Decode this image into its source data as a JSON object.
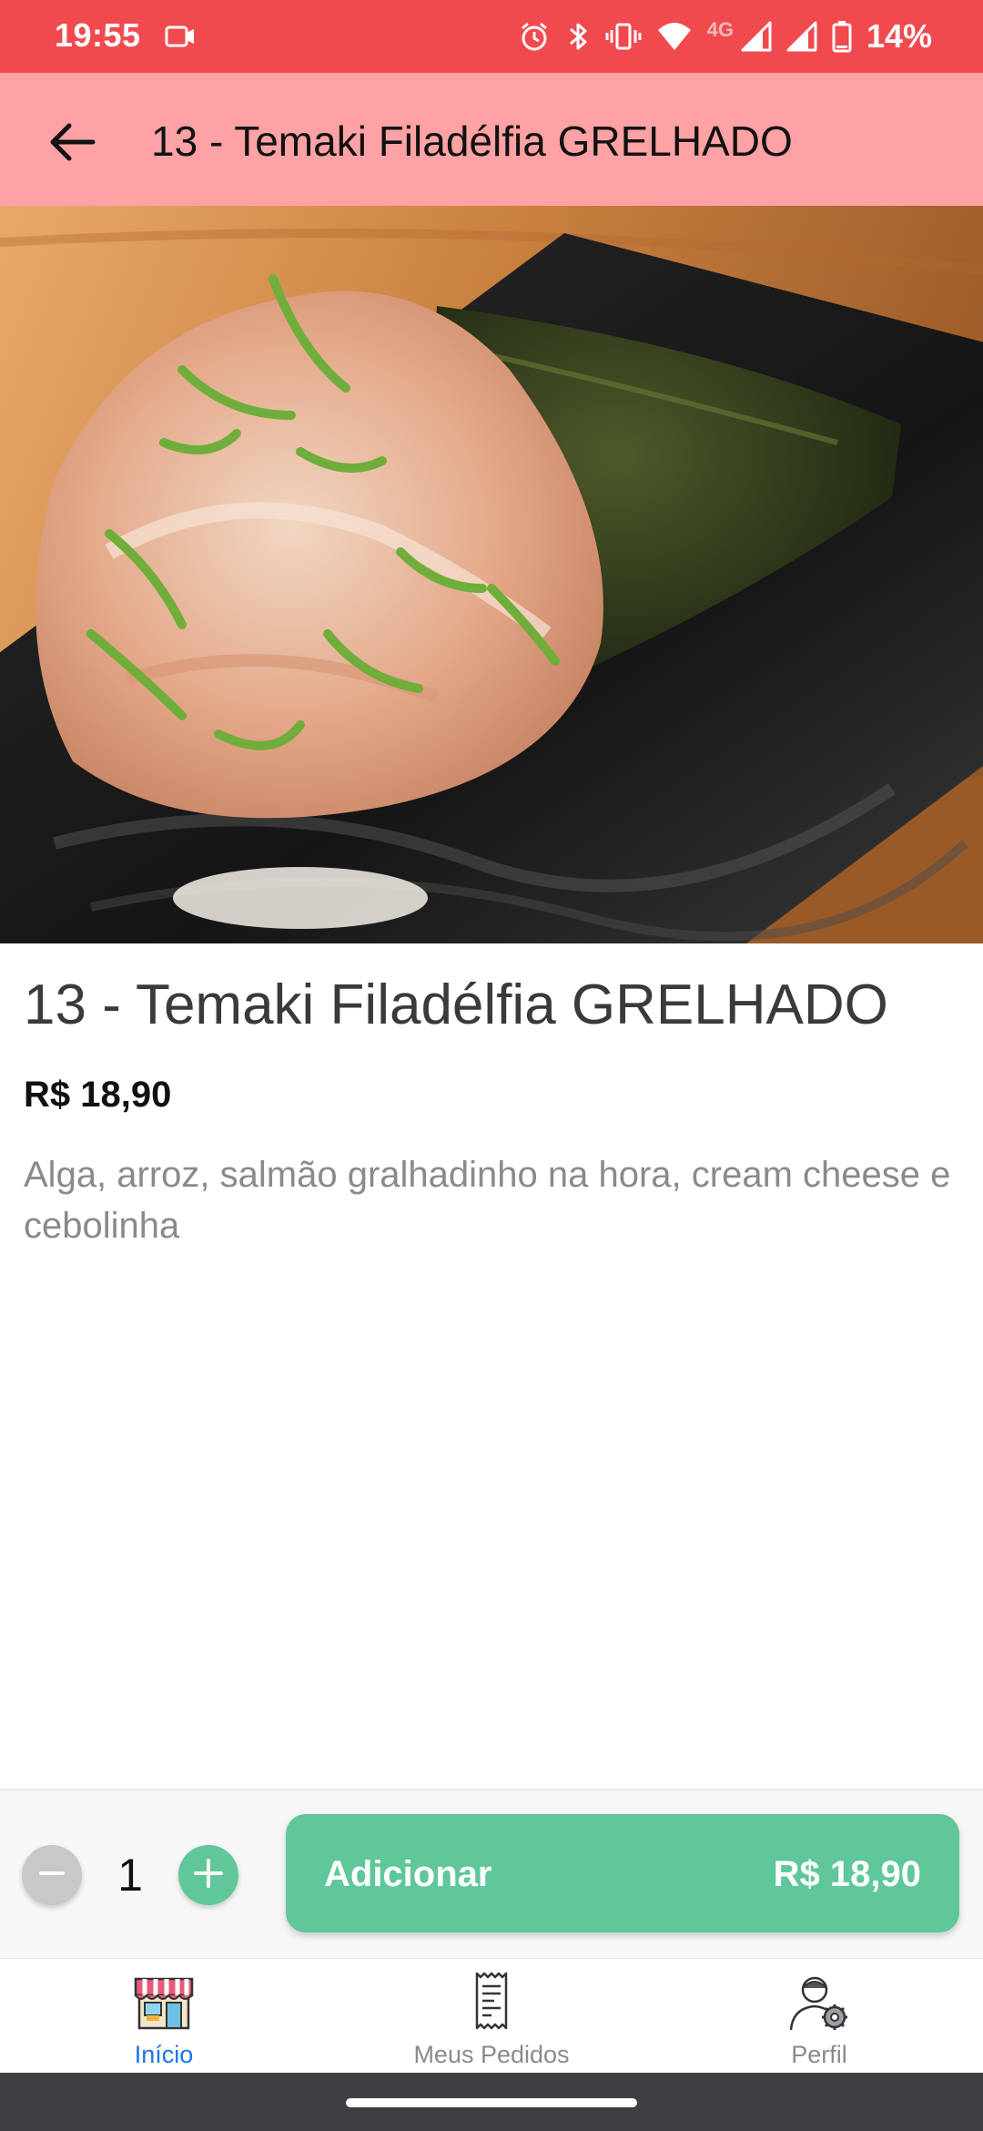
{
  "status_bar": {
    "time": "19:55",
    "network_label": "4G",
    "battery_percent": "14%",
    "background_color": "#F04A4F",
    "icons": [
      "video-camera-icon",
      "alarm-icon",
      "bluetooth-icon",
      "vibrate-icon",
      "wifi-icon",
      "signal-icon",
      "signal-icon",
      "battery-icon"
    ]
  },
  "app_bar": {
    "title": "13 - Temaki Filadélfia GRELHADO",
    "back_icon": "arrow-left-icon",
    "background_color": "#FFA2A5"
  },
  "product": {
    "image_alt": "Temaki de salmão grelhado",
    "name": "13 - Temaki Filadélfia GRELHADO",
    "price": "R$ 18,90",
    "description": "Alga, arroz, salmão gralhadinho na hora, cream cheese e cebolinha"
  },
  "order": {
    "quantity": "1",
    "minus_icon": "minus-icon",
    "plus_icon": "plus-icon",
    "add_label": "Adicionar",
    "add_price": "R$ 18,90",
    "accent_color": "#5FC79A"
  },
  "bottom_nav": {
    "items": [
      {
        "label": "Início",
        "icon": "storefront-icon",
        "active": true
      },
      {
        "label": "Meus Pedidos",
        "icon": "receipt-icon",
        "active": false
      },
      {
        "label": "Perfil",
        "icon": "user-settings-icon",
        "active": false
      }
    ],
    "active_color": "#1A73E8"
  }
}
